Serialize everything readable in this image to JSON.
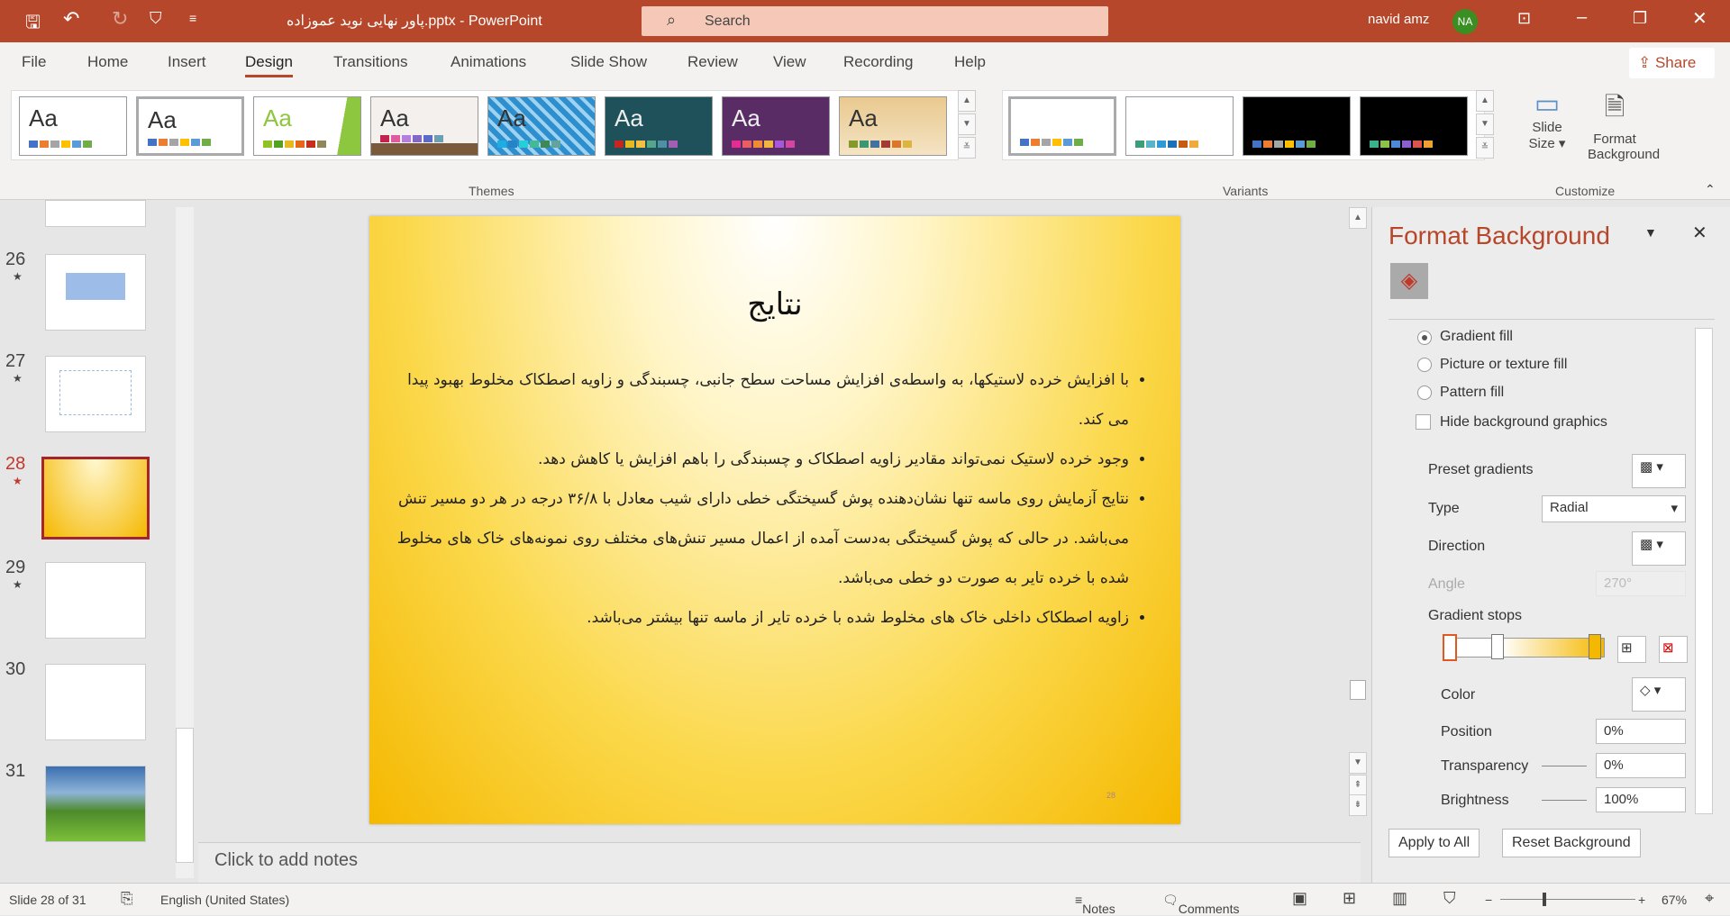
{
  "titlebar": {
    "filename": "پاور نهایی نوید عموزاده.pptx",
    "separator": "-",
    "app": "PowerPoint",
    "search_placeholder": "Search",
    "user": "navid amz",
    "initials": "NA",
    "accent": "#b7472a"
  },
  "tabs": [
    "File",
    "Home",
    "Insert",
    "Design",
    "Transitions",
    "Animations",
    "Slide Show",
    "Review",
    "View",
    "Recording",
    "Help"
  ],
  "active_tab": "Design",
  "share": "Share",
  "ribbon": {
    "themes_label": "Themes",
    "variants_label": "Variants",
    "customize_label": "Customize",
    "theme_sample": "Aa",
    "slide_size": "Slide Size",
    "format_background": "Format Background"
  },
  "thumbnails": [
    {
      "n": "26"
    },
    {
      "n": "27"
    },
    {
      "n": "28",
      "selected": true
    },
    {
      "n": "29"
    },
    {
      "n": "30"
    },
    {
      "n": "31"
    }
  ],
  "slide": {
    "title": "نتایج",
    "bullets": [
      "با افزایش خرده لاستیکها، به واسطه‌ی افزایش مساحت سطح جانبی، چسبندگی و زاویه اصطکاک مخلوط بهبود پیدا می کند.",
      "وجود خرده لاستیک نمی‌تواند مقادیر زاویه اصطکاک و چسبندگی را باهم افزایش یا کاهش دهد.",
      "نتایج آزمایش روی ماسه تنها نشان‌دهنده پوش گسیختگی خطی دارای شیب معادل با ۳۶/۸ درجه در هر دو مسیر تنش می‌باشد. در حالی که پوش گسیختگی به‌دست آمده از اعمال مسیر تنش‌های مختلف روی نمونه‌های خاک های مخلوط شده با خرده تایر به صورت دو خطی می‌باشد.",
      "زاویه اصطکاک داخلی خاک های مخلوط شده با خرده تایر از ماسه تنها بیشتر می‌باشد."
    ],
    "page_number": "28"
  },
  "notes_placeholder": "Click to add notes",
  "panel": {
    "title": "Format Background",
    "fill_options": [
      "Gradient fill",
      "Picture or texture fill",
      "Pattern fill"
    ],
    "selected_fill": "Gradient fill",
    "hide_bg": "Hide background graphics",
    "hide_bg_checked": false,
    "preset_gradients": "Preset gradients",
    "type_label": "Type",
    "type_value": "Radial",
    "direction": "Direction",
    "angle_label": "Angle",
    "angle_value": "270°",
    "gradient_stops": "Gradient stops",
    "color": "Color",
    "position_label": "Position",
    "position_value": "0%",
    "transparency_label": "Transparency",
    "transparency_value": "0%",
    "brightness_label": "Brightness",
    "brightness_value": "100%",
    "apply_all": "Apply to All",
    "reset": "Reset Background"
  },
  "status": {
    "slide": "Slide 28 of 31",
    "language": "English (United States)",
    "notes": "Notes",
    "comments": "Comments",
    "zoom": "67%"
  }
}
